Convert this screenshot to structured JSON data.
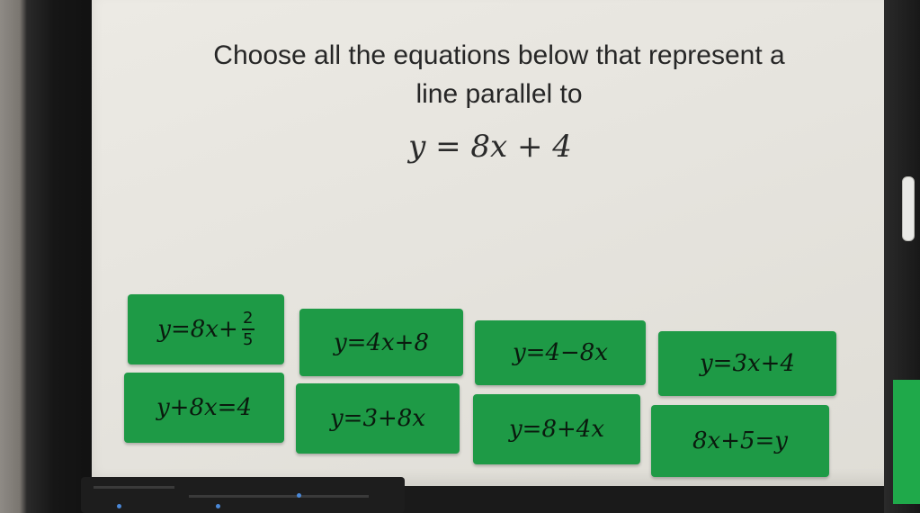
{
  "question": {
    "line1": "Choose all the equations below that represent a",
    "line2": "line parallel to",
    "equation": "y = 8x + 4"
  },
  "choices": [
    {
      "id": "a",
      "pre": "y=8x+",
      "frac_num": "2",
      "frac_den": "5"
    },
    {
      "id": "b",
      "label": "y=4x+8"
    },
    {
      "id": "c",
      "label": "y=4−8x"
    },
    {
      "id": "d",
      "label": "y=3x+4"
    },
    {
      "id": "e",
      "label": "y+8x=4"
    },
    {
      "id": "f",
      "label": "y=3+8x"
    },
    {
      "id": "g",
      "label": "y=8+4x"
    },
    {
      "id": "h",
      "label": "8x+5=y"
    }
  ],
  "colors": {
    "tile": "#1e9a46",
    "background": "#e6e4de",
    "text": "#262626"
  }
}
